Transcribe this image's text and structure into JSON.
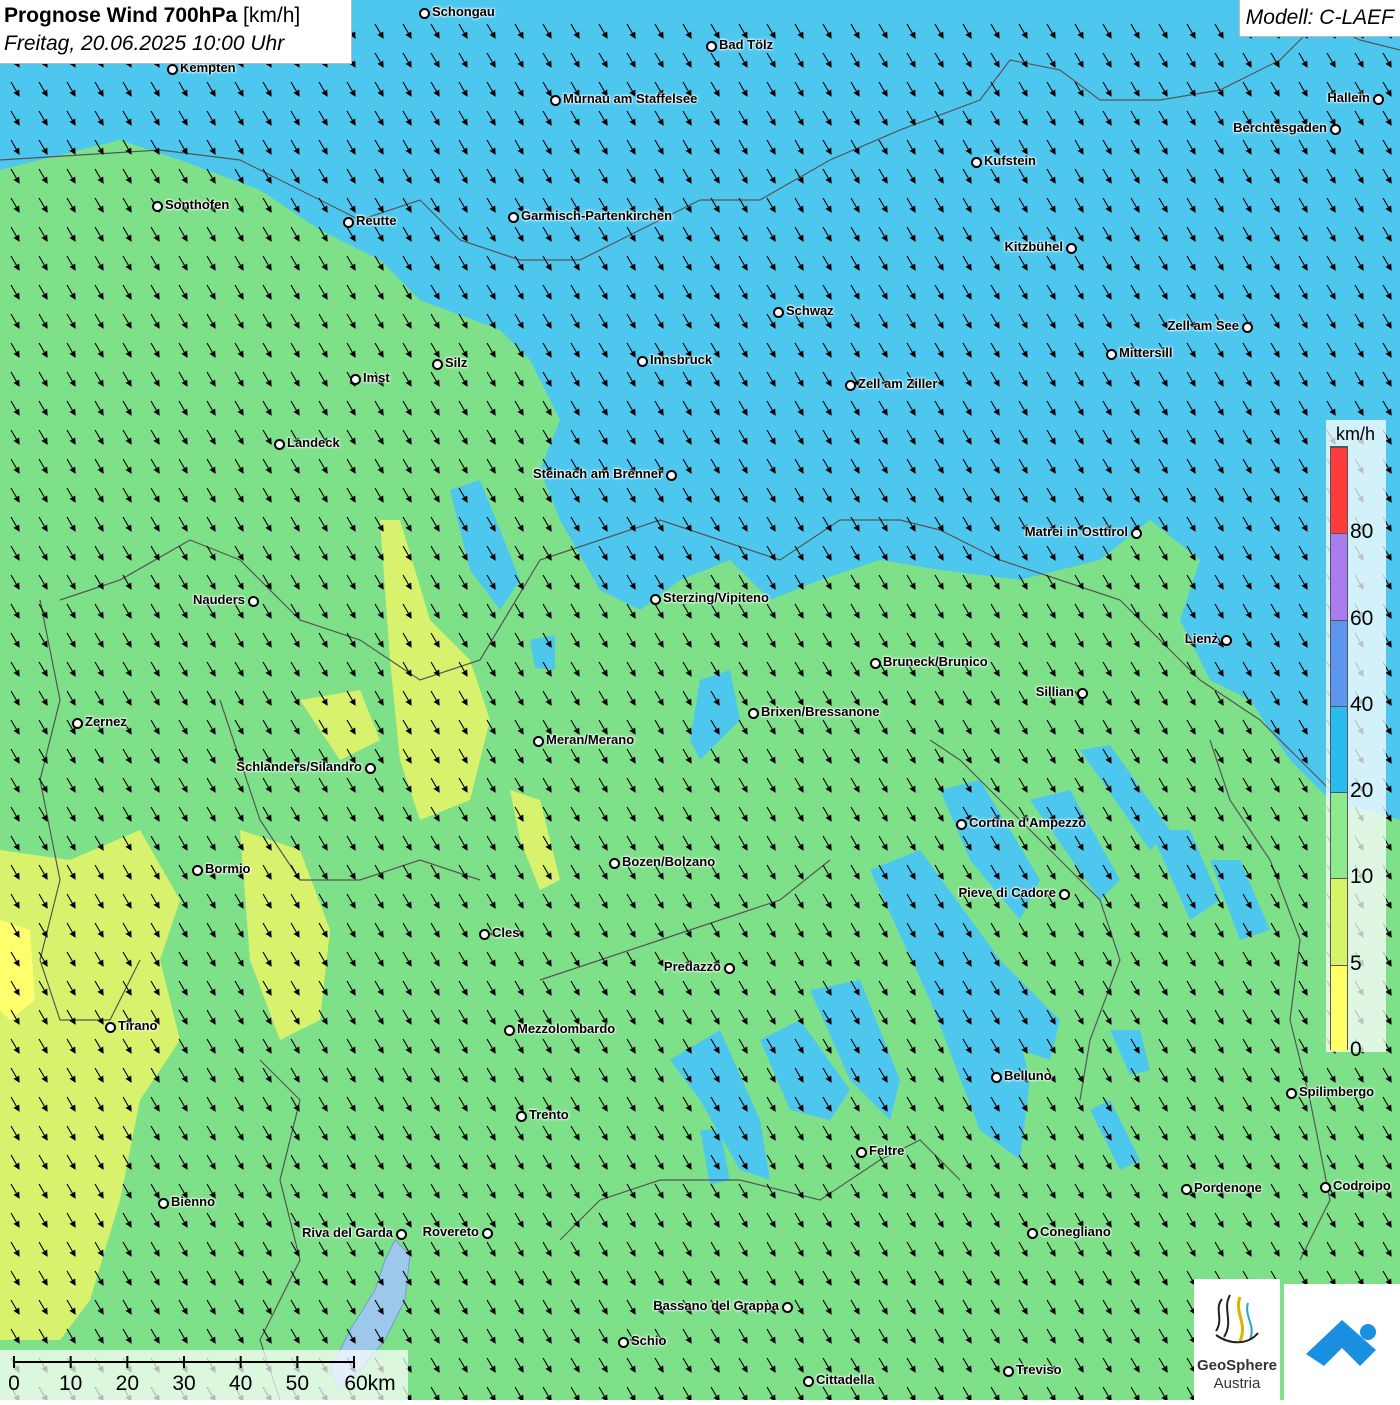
{
  "title": {
    "main": "Prognose Wind 700hPa",
    "unit": "[km/h]",
    "date": "Freitag, 20.06.2025 10:00 Uhr"
  },
  "model": "Modell: C-LAEF",
  "legend": {
    "unit": "km/h",
    "ticks": [
      "80",
      "60",
      "40",
      "20",
      "10",
      "5",
      "0"
    ],
    "colors": [
      "#ff3b3b",
      "#a97cf0",
      "#5b95ee",
      "#2bbcef",
      "#8eea8e",
      "#d8f56a",
      "#ffff66"
    ]
  },
  "scale": {
    "labels": [
      "0",
      "10",
      "20",
      "30",
      "40",
      "50",
      "60km"
    ]
  },
  "wind_direction": "northwest",
  "colors": {
    "strong": "#4ec7ef",
    "medium": "#7fe08a",
    "weak": "#d9f26d"
  },
  "cities": [
    {
      "name": "Schongau",
      "side": "right"
    },
    {
      "name": "Bad Tölz",
      "side": "right"
    },
    {
      "name": "Kempten",
      "side": "right"
    },
    {
      "name": "Murnau am Staffelsee",
      "side": "right"
    },
    {
      "name": "Hallein",
      "side": "left"
    },
    {
      "name": "Berchtesgaden",
      "side": "left"
    },
    {
      "name": "Kufstein",
      "side": "right"
    },
    {
      "name": "Sonthofen",
      "side": "right"
    },
    {
      "name": "Reutte",
      "side": "right"
    },
    {
      "name": "Garmisch-Partenkirchen",
      "side": "right"
    },
    {
      "name": "Kitzbühel",
      "side": "left"
    },
    {
      "name": "Schwaz",
      "side": "right"
    },
    {
      "name": "Zell am See",
      "side": "left"
    },
    {
      "name": "Innsbruck",
      "side": "right"
    },
    {
      "name": "Mittersill",
      "side": "right"
    },
    {
      "name": "Silz",
      "side": "right"
    },
    {
      "name": "Imst",
      "side": "right"
    },
    {
      "name": "Zell am Ziller",
      "side": "right"
    },
    {
      "name": "Landeck",
      "side": "right"
    },
    {
      "name": "Steinach am Brenner",
      "side": "left"
    },
    {
      "name": "Matrei in Osttirol",
      "side": "left"
    },
    {
      "name": "Nauders",
      "side": "left"
    },
    {
      "name": "Sterzing/Vipiteno",
      "side": "right"
    },
    {
      "name": "Lienz",
      "side": "left"
    },
    {
      "name": "Bruneck/Brunico",
      "side": "right"
    },
    {
      "name": "Sillian",
      "side": "left"
    },
    {
      "name": "Zernez",
      "side": "right"
    },
    {
      "name": "Brixen/Bressanone",
      "side": "right"
    },
    {
      "name": "Meran/Merano",
      "side": "right"
    },
    {
      "name": "Schlanders/Silandro",
      "side": "left"
    },
    {
      "name": "Cortina d'Ampezzo",
      "side": "right"
    },
    {
      "name": "Bozen/Bolzano",
      "side": "right"
    },
    {
      "name": "Bormio",
      "side": "right"
    },
    {
      "name": "Pieve di Cadore",
      "side": "left"
    },
    {
      "name": "Cles",
      "side": "right"
    },
    {
      "name": "Predazzo",
      "side": "left"
    },
    {
      "name": "Tirano",
      "side": "right"
    },
    {
      "name": "Mezzolombardo",
      "side": "right"
    },
    {
      "name": "Belluno",
      "side": "right"
    },
    {
      "name": "Spilimbergo",
      "side": "right"
    },
    {
      "name": "Trento",
      "side": "right"
    },
    {
      "name": "Feltre",
      "side": "right"
    },
    {
      "name": "Pordenone",
      "side": "right"
    },
    {
      "name": "Codroipo",
      "side": "right"
    },
    {
      "name": "Bienno",
      "side": "right"
    },
    {
      "name": "Riva del Garda",
      "side": "left"
    },
    {
      "name": "Rovereto",
      "side": "left"
    },
    {
      "name": "Conegliano",
      "side": "right"
    },
    {
      "name": "Bassano del Grappa",
      "side": "left"
    },
    {
      "name": "Schio",
      "side": "right"
    },
    {
      "name": "Treviso",
      "side": "right"
    },
    {
      "name": "Cittadella",
      "side": "right"
    }
  ],
  "logos": {
    "geosphere_line1": "GeoSphere",
    "geosphere_line2": "Austria"
  }
}
